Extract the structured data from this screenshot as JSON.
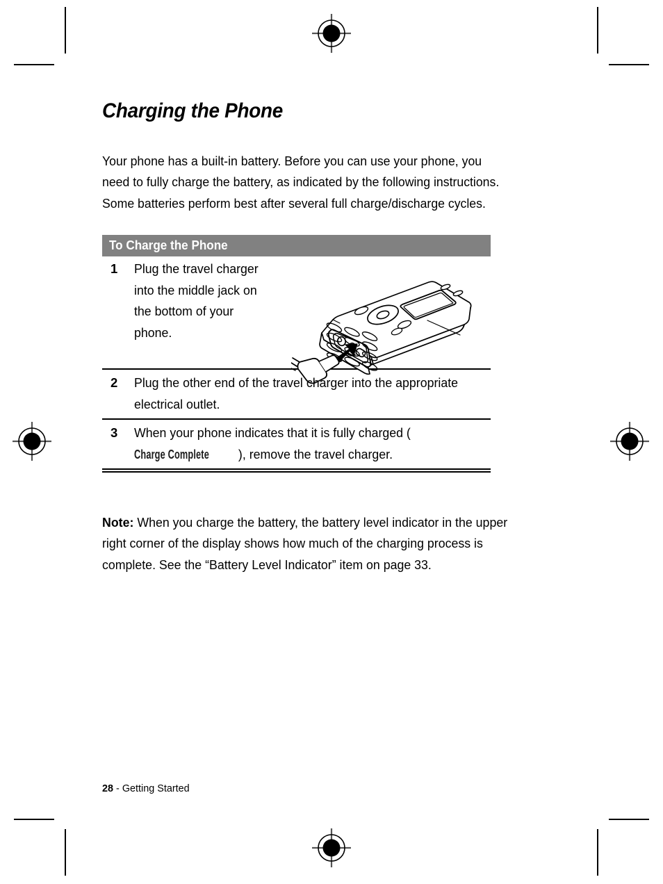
{
  "document": {
    "heading": "Charging the Phone",
    "intro": "Your phone has a built-in battery. Before you can use your phone, you need to fully charge the battery, as indicated by the following instructions. Some batteries perform best after several full charge/discharge cycles.",
    "procedure": {
      "header": "To Charge the Phone",
      "steps": [
        {
          "number": "1",
          "text": "Plug the travel charger into the middle jack on the bottom of your phone."
        },
        {
          "number": "2",
          "text": "Plug the other end of the travel charger into the appropriate electrical outlet."
        },
        {
          "number": "3",
          "text_before": "When your phone indicates that it is fully charged (",
          "device_text": "Charge Complete",
          "text_after": "), remove the travel charger."
        }
      ]
    },
    "note": {
      "label": "Note:",
      "text": "When you charge the battery, the battery level indicator in the upper right corner of the display shows how much of the charging process is complete. See the “Battery Level Indicator” item on page 33."
    },
    "footer": {
      "page_number": "28",
      "separator": " - ",
      "section": "Getting Started"
    },
    "illustration": {
      "caption": "mobile phone shown in perspective with travel charger plug being inserted into the middle jack at the bottom of the phone",
      "arrow": "insertion-arrow"
    },
    "colors": {
      "header_bar": "#818181",
      "header_text": "#ffffff",
      "body_text": "#000000",
      "device_text": "#1c1c1c",
      "page_background": "#ffffff"
    },
    "print_marks": {
      "registration_targets": 4,
      "crop_marks": 8
    }
  }
}
